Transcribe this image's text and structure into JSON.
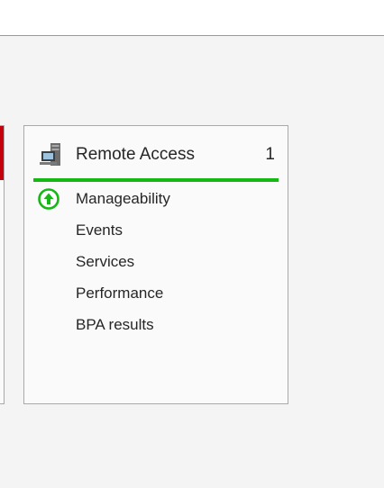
{
  "tile": {
    "title": "Remote Access",
    "count": "1",
    "accent_color": "#15b815",
    "items": [
      {
        "label": "Manageability",
        "icon": "up-arrow-circle-icon",
        "status_color": "#15b815"
      },
      {
        "label": "Events"
      },
      {
        "label": "Services"
      },
      {
        "label": "Performance"
      },
      {
        "label": "BPA results"
      }
    ]
  },
  "colors": {
    "prev_tile_accent": "#c4000c"
  }
}
